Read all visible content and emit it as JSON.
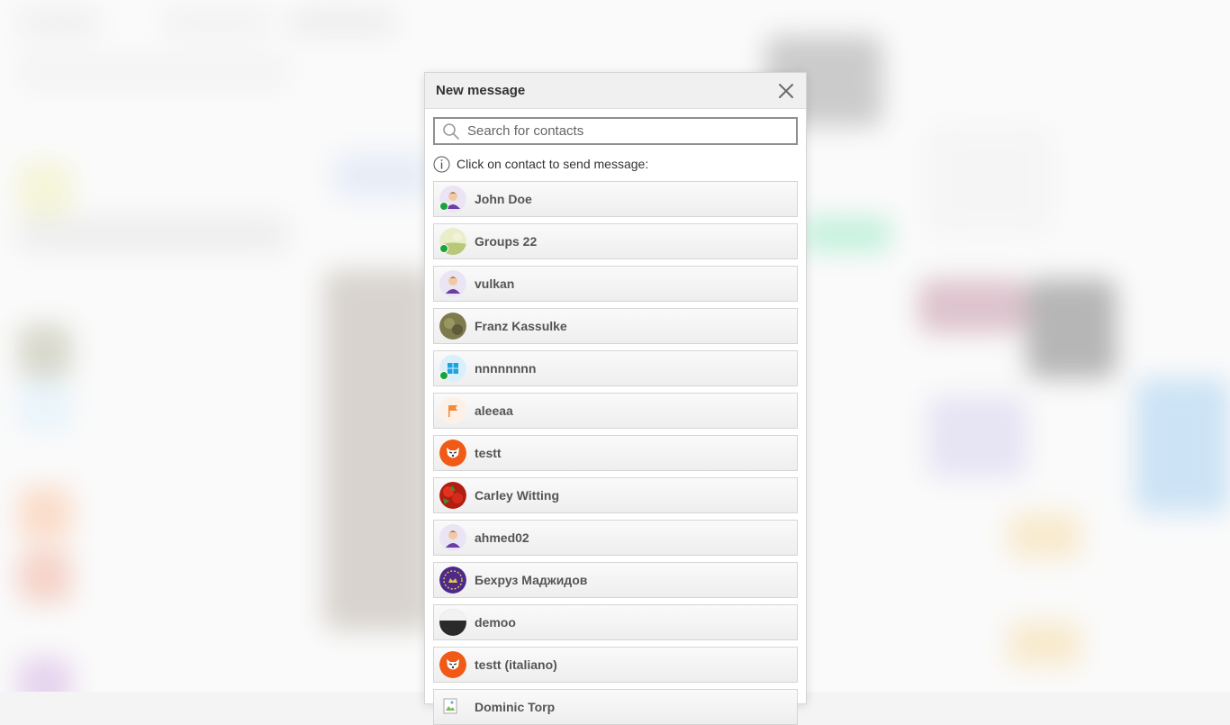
{
  "modal": {
    "title": "New message",
    "search_placeholder": "Search for contacts",
    "hint": "Click on contact to send message:"
  },
  "contacts": [
    {
      "name": "John Doe",
      "avatar": "person-avatar-icon",
      "online": true
    },
    {
      "name": "Groups 22",
      "avatar": "landscape-avatar-icon",
      "online": true
    },
    {
      "name": "vulkan",
      "avatar": "person-avatar-icon",
      "online": false
    },
    {
      "name": "Franz Kassulke",
      "avatar": "photo-avatar-icon",
      "online": false
    },
    {
      "name": "nnnnnnnn",
      "avatar": "windows-logo-avatar-icon",
      "online": true
    },
    {
      "name": "aleeaa",
      "avatar": "flag-avatar-icon",
      "online": false
    },
    {
      "name": "testt",
      "avatar": "fox-avatar-icon",
      "online": false
    },
    {
      "name": "Carley Witting",
      "avatar": "tomatoes-avatar-icon",
      "online": false
    },
    {
      "name": "ahmed02",
      "avatar": "person-avatar-icon",
      "online": false
    },
    {
      "name": "Бехруз Маджидов",
      "avatar": "emblem-avatar-icon",
      "online": false
    },
    {
      "name": "demoo",
      "avatar": "dark-avatar-icon",
      "online": false
    },
    {
      "name": "testt (italiano)",
      "avatar": "fox-avatar-icon",
      "online": false
    },
    {
      "name": "Dominic Torp",
      "avatar": "broken-image-avatar-icon",
      "online": false
    }
  ],
  "colors": {
    "online_status": "#1aa33c",
    "header_bg": "#f0f0f0",
    "row_border": "#d5d5d5"
  }
}
